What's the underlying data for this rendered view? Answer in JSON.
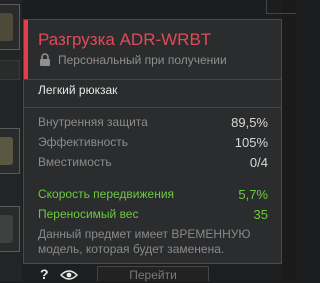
{
  "tooltip": {
    "title": "Разгрузка ADR-WRBT",
    "binding": "Персональный при получении",
    "category": "Легкий рюкзак",
    "stats": [
      {
        "label": "Внутренняя защита",
        "value": "89,5%"
      },
      {
        "label": "Эффективность",
        "value": "105%"
      },
      {
        "label": "Вместимость",
        "value": "0/4"
      }
    ],
    "bonuses": [
      {
        "label": "Скорость передвижения",
        "value": "5,7%"
      },
      {
        "label": "Переносимый вес",
        "value": "35"
      }
    ],
    "note": "Данный предмет имеет ВРЕМЕННУЮ модель, которая будет заменена."
  },
  "controls": {
    "help_label": "?",
    "go_label": "Перейти"
  },
  "colors": {
    "accent": "#e0404d",
    "title": "#e14b57",
    "bonus": "#6ccb3e"
  },
  "icons": [
    "lock-icon",
    "help-icon",
    "eye-icon"
  ]
}
